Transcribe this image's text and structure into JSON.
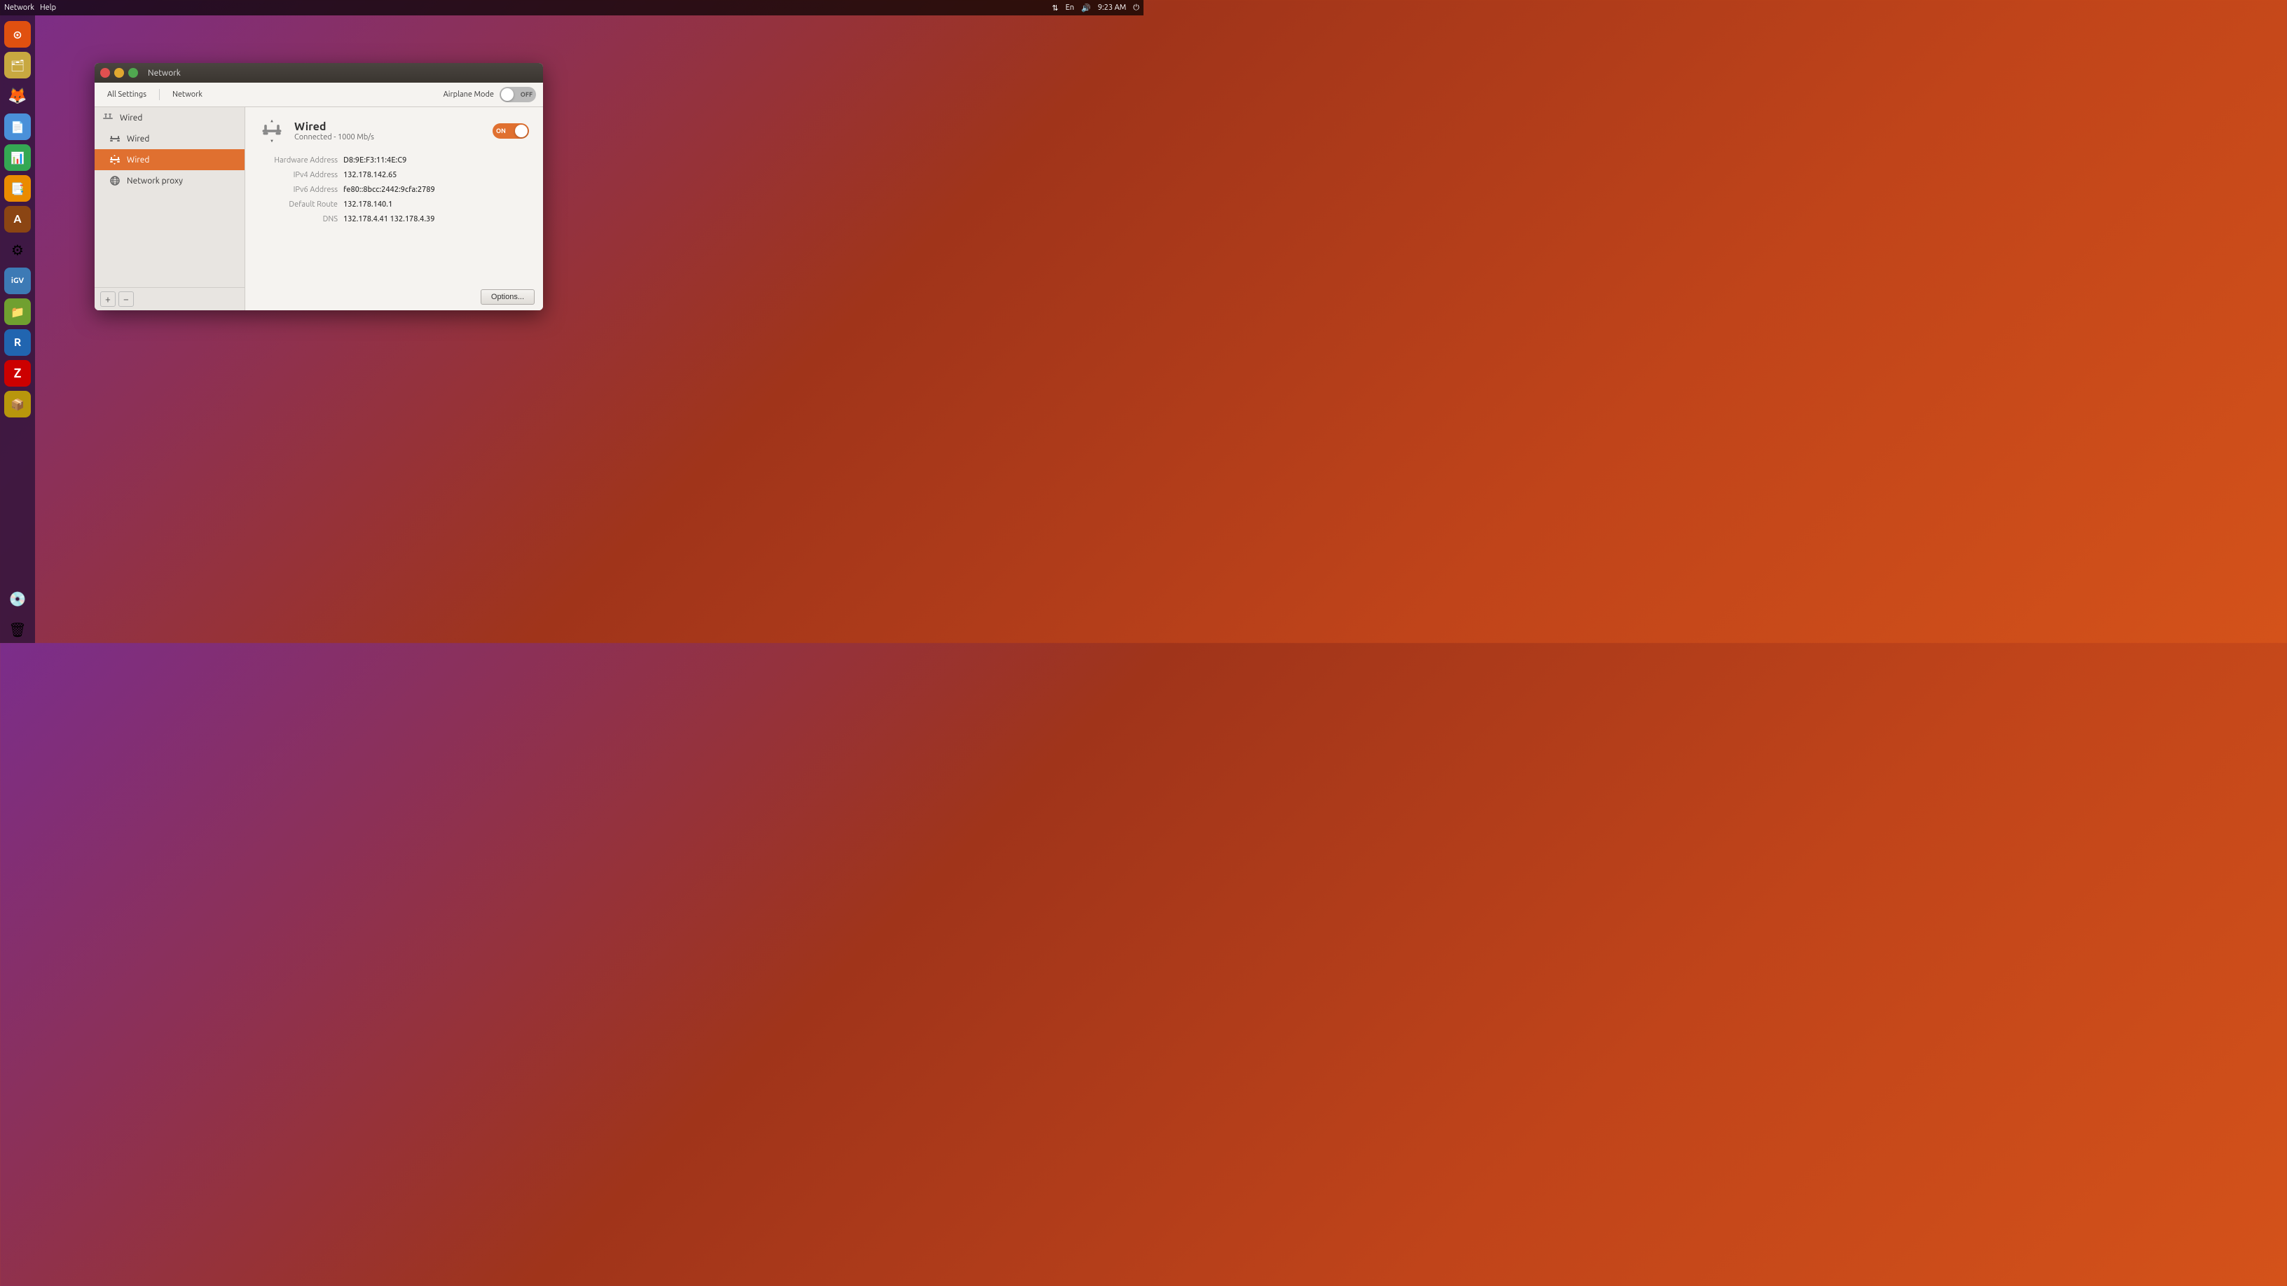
{
  "taskbar": {
    "menu_items": [
      "Network",
      "Help"
    ],
    "right_items": {
      "network_icon": "⇅",
      "keyboard": "En",
      "volume": "🔊",
      "time": "9:23 AM",
      "power": "⏻"
    }
  },
  "sidebar": {
    "icons": [
      {
        "name": "ubuntu-icon",
        "label": "Ubuntu",
        "symbol": "🔶"
      },
      {
        "name": "files-icon",
        "label": "Files",
        "symbol": "🗂"
      },
      {
        "name": "firefox-icon",
        "label": "Firefox",
        "symbol": "🦊"
      },
      {
        "name": "docs-icon",
        "label": "Documents",
        "symbol": "📄"
      },
      {
        "name": "sheets-icon",
        "label": "Spreadsheet",
        "symbol": "📊"
      },
      {
        "name": "present-icon",
        "label": "Presentations",
        "symbol": "📑"
      },
      {
        "name": "fonts-icon",
        "label": "Font Manager",
        "symbol": "A"
      },
      {
        "name": "settings-icon",
        "label": "Settings",
        "symbol": "⚙"
      },
      {
        "name": "igv-icon",
        "label": "IGV",
        "symbol": "📈"
      },
      {
        "name": "files2-icon",
        "label": "Files2",
        "symbol": "📁"
      },
      {
        "name": "r-icon",
        "label": "R Studio",
        "symbol": "R"
      },
      {
        "name": "ftp-icon",
        "label": "FTP",
        "symbol": "Z"
      },
      {
        "name": "archive-icon",
        "label": "Archive",
        "symbol": "📦"
      },
      {
        "name": "disk-icon",
        "label": "Disk",
        "symbol": "💿"
      },
      {
        "name": "trash-icon",
        "label": "Trash",
        "symbol": "🗑"
      }
    ]
  },
  "window": {
    "title": "Network",
    "menu": [
      "Network",
      "Help"
    ],
    "toolbar": {
      "all_settings": "All Settings",
      "network": "Network"
    },
    "airplane_mode_label": "Airplane Mode",
    "airplane_mode_state": "OFF",
    "left_panel": {
      "items": [
        {
          "label": "Wired",
          "icon": "🔗",
          "type": "header"
        },
        {
          "label": "Wired",
          "icon": "wired",
          "selected": false
        },
        {
          "label": "Wired",
          "icon": "wired-active",
          "selected": true
        },
        {
          "label": "Network proxy",
          "icon": "proxy",
          "selected": false
        }
      ],
      "add_label": "+",
      "remove_label": "−"
    },
    "right_panel": {
      "connection_name": "Wired",
      "connection_status": "Connected - 1000 Mb/s",
      "toggle_state": "ON",
      "details": {
        "hardware_address_label": "Hardware Address",
        "hardware_address_value": "D8:9E:F3:11:4E:C9",
        "ipv4_label": "IPv4 Address",
        "ipv4_value": "132.178.142.65",
        "ipv6_label": "IPv6 Address",
        "ipv6_value": "fe80::8bcc:2442:9cfa:2789",
        "default_route_label": "Default Route",
        "default_route_value": "132.178.140.1",
        "dns_label": "DNS",
        "dns_value": "132.178.4.41 132.178.4.39"
      },
      "options_button": "Options..."
    }
  }
}
